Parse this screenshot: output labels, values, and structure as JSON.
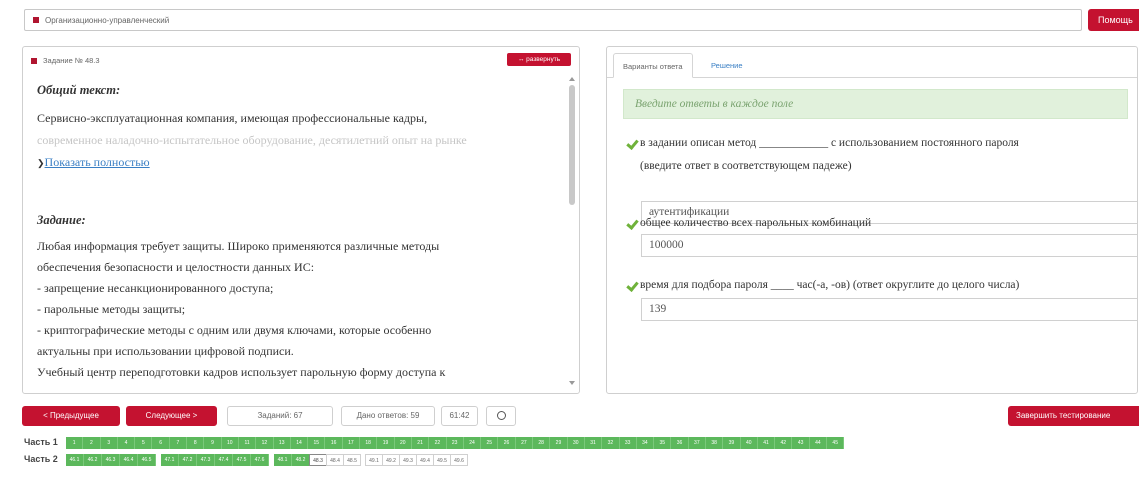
{
  "topbar": {
    "section": "Организационно-управленческий",
    "help_label": "Помощь"
  },
  "task": {
    "header": "Задание № 48.3",
    "expand_label": "↔ развернуть",
    "general_heading": "Общий текст:",
    "general_line1": "Сервисно-эксплуатационная компания, имеющая профессиональные кадры,",
    "general_line2": "современное наладочно-испытательное оборудование, десятилетний опыт на рынке",
    "show_more": "Показать полностью",
    "task_heading": "Задание:",
    "task_lines": [
      "Любая информация требует защиты. Широко применяются различные методы",
      "обеспечения безопасности и целостности данных ИС:",
      "- запрещение несанкционированного доступа;",
      "- парольные методы защиты;",
      "- криптографические методы с одним или двумя ключами, которые особенно",
      "актуальны при использовании цифровой подписи.",
      "Учебный центр переподготовки кадров использует парольную форму доступа к"
    ]
  },
  "answers": {
    "tabs": [
      "Варианты ответа",
      "Решение"
    ],
    "alert": "Введите ответы в каждое поле",
    "questions": [
      {
        "line1": "в задании описан метод ____________ с использованием постоянного пароля",
        "line2": "(введите ответ в соответствующем падеже)",
        "value": "аутентификации"
      },
      {
        "line1": "общее количество всех парольных комбинаций",
        "value": "100000"
      },
      {
        "line1": "время для подбора пароля ____ час(-а, -ов) (ответ округлите до целого числа)",
        "value": "139"
      }
    ]
  },
  "nav": {
    "prev": "< Предыдущее",
    "next": "Следующее >",
    "tasks_total": "Заданий: 67",
    "answered": "Дано ответов: 59",
    "timer": "61:42",
    "finish": "Завершить тестирование"
  },
  "parts": {
    "part1_label": "Часть 1",
    "part2_label": "Часть 2",
    "part1_cells": [
      "1",
      "2",
      "3",
      "4",
      "5",
      "6",
      "7",
      "8",
      "9",
      "10",
      "11",
      "12",
      "13",
      "14",
      "15",
      "16",
      "17",
      "18",
      "19",
      "20",
      "21",
      "22",
      "23",
      "24",
      "25",
      "26",
      "27",
      "28",
      "29",
      "30",
      "31",
      "32",
      "33",
      "34",
      "35",
      "36",
      "37",
      "38",
      "39",
      "40",
      "41",
      "42",
      "43",
      "44",
      "45"
    ],
    "part2_groups": [
      [
        {
          "t": "46.1",
          "s": "done"
        },
        {
          "t": "46.2",
          "s": "done"
        },
        {
          "t": "46.3",
          "s": "done"
        },
        {
          "t": "46.4",
          "s": "done"
        },
        {
          "t": "46.5",
          "s": "done"
        }
      ],
      [
        {
          "t": "47.1",
          "s": "done"
        },
        {
          "t": "47.2",
          "s": "done"
        },
        {
          "t": "47.3",
          "s": "done"
        },
        {
          "t": "47.4",
          "s": "done"
        },
        {
          "t": "47.5",
          "s": "done"
        },
        {
          "t": "47.6",
          "s": "done"
        }
      ],
      [
        {
          "t": "48.1",
          "s": "done"
        },
        {
          "t": "48.2",
          "s": "done"
        },
        {
          "t": "48.3",
          "s": "current"
        },
        {
          "t": "48.4",
          "s": "open"
        },
        {
          "t": "48.5",
          "s": "open"
        }
      ],
      [
        {
          "t": "49.1",
          "s": "open"
        },
        {
          "t": "49.2",
          "s": "open"
        },
        {
          "t": "49.3",
          "s": "open"
        },
        {
          "t": "49.4",
          "s": "open"
        },
        {
          "t": "49.5",
          "s": "open"
        },
        {
          "t": "49.6",
          "s": "open"
        }
      ]
    ]
  },
  "colors": {
    "accent": "#c41230",
    "done": "#5cb85c",
    "link": "#3a7fc4"
  }
}
